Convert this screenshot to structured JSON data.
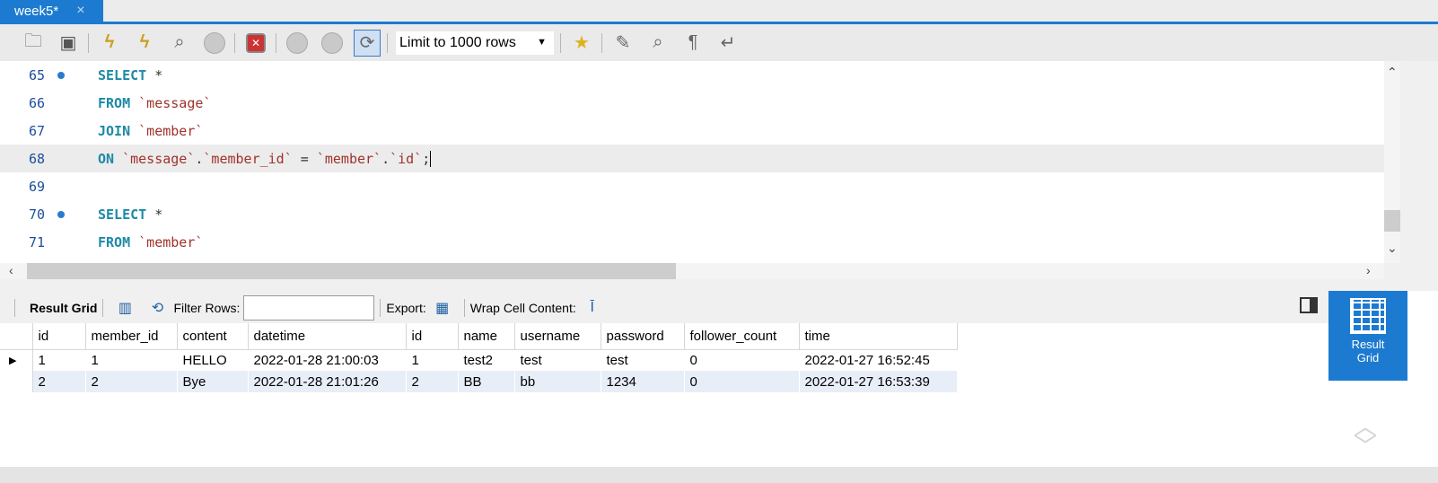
{
  "tab": {
    "title": "week5*",
    "close": "×"
  },
  "toolbar": {
    "limit_label": "Limit to 1000 rows",
    "icons": [
      "folder-icon",
      "save-icon",
      "execute-icon",
      "execute-current-icon",
      "explain-icon",
      "stop-icon",
      "toggle-stop-on-error-icon",
      "commit-icon",
      "rollback-icon",
      "autocommit-icon",
      "beautify-star-icon",
      "beautify-icon",
      "find-icon",
      "invisible-chars-icon",
      "wrap-icon"
    ]
  },
  "editor": {
    "lines": [
      {
        "num": "65",
        "dot": true
      },
      {
        "num": "66",
        "dot": false
      },
      {
        "num": "67",
        "dot": false
      },
      {
        "num": "68",
        "dot": false
      },
      {
        "num": "69",
        "dot": false
      },
      {
        "num": "70",
        "dot": true
      },
      {
        "num": "71",
        "dot": false
      }
    ],
    "tokens": {
      "select": "SELECT",
      "star": " *",
      "from": "FROM",
      "join": "JOIN",
      "on": "ON",
      "message": "`message`",
      "member": "`member`",
      "member_id": "`member_id`",
      "id": "`id`",
      "dot": ".",
      "eq": " = ",
      "semi": ";"
    }
  },
  "result_toolbar": {
    "title": "Result Grid",
    "filter_label": "Filter Rows:",
    "filter_value": "",
    "export_label": "Export:",
    "wrap_label": "Wrap Cell Content:"
  },
  "grid": {
    "columns": [
      "id",
      "member_id",
      "content",
      "datetime",
      "id",
      "name",
      "username",
      "password",
      "follower_count",
      "time"
    ],
    "rows": [
      [
        "1",
        "1",
        "HELLO",
        "2022-01-28 21:00:03",
        "1",
        "test2",
        "test",
        "test",
        "0",
        "2022-01-27 16:52:45"
      ],
      [
        "2",
        "2",
        "Bye",
        "2022-01-28 21:01:26",
        "2",
        "BB",
        "bb",
        "1234",
        "0",
        "2022-01-27 16:53:39"
      ]
    ],
    "current_row_marker": "▶"
  },
  "side_panel": {
    "result_grid_line1": "Result",
    "result_grid_line2": "Grid"
  }
}
